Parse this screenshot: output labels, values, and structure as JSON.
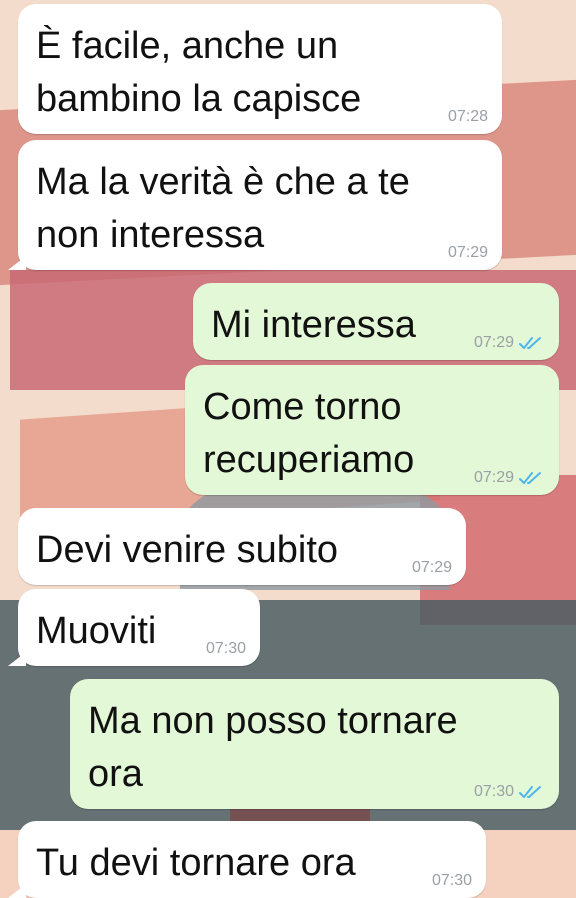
{
  "chat": {
    "messages": [
      {
        "direction": "in",
        "text": [
          "È facile, anche un",
          "bambino la capisce"
        ],
        "time": "07:28"
      },
      {
        "direction": "in",
        "text": [
          "Ma la verità è che a te",
          "non interessa"
        ],
        "time": "07:29"
      },
      {
        "direction": "out",
        "text": [
          "Mi interessa"
        ],
        "time": "07:29",
        "status": "read"
      },
      {
        "direction": "out",
        "text": [
          "Come torno",
          "recuperiamo"
        ],
        "time": "07:29",
        "status": "read"
      },
      {
        "direction": "in",
        "text": [
          "Devi venire subito"
        ],
        "time": "07:29"
      },
      {
        "direction": "in",
        "text": [
          "Muoviti"
        ],
        "time": "07:30"
      },
      {
        "direction": "out",
        "text": [
          "Ma non posso tornare",
          "ora"
        ],
        "time": "07:30",
        "status": "read"
      },
      {
        "direction": "in",
        "text": [
          "Tu devi tornare ora"
        ],
        "time": "07:30"
      }
    ]
  },
  "colors": {
    "incoming_bubble": "#ffffff",
    "outgoing_bubble": "#e3f8d6",
    "read_ticks": "#4fb6ec",
    "timestamp": "#9aa0a6"
  },
  "icons": {
    "read_status": "double-check-icon"
  }
}
